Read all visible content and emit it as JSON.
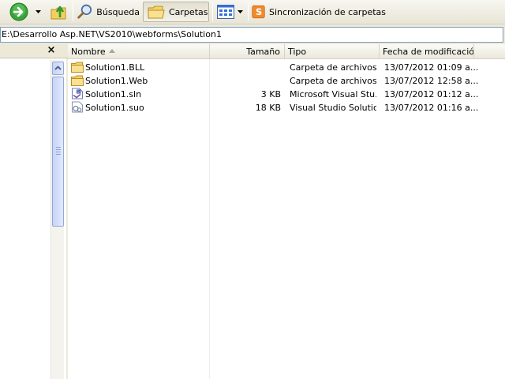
{
  "toolbar": {
    "search_label": "Búsqueda",
    "folders_label": "Carpetas",
    "sync_label": "Sincronización de carpetas"
  },
  "address": {
    "path": "E:\\Desarrollo Asp.NET\\VS2010\\webforms\\Solution1"
  },
  "folder_pane": {
    "close_glyph": "×"
  },
  "columns": {
    "name": "Nombre",
    "size": "Tamaño",
    "type": "Tipo",
    "modified": "Fecha de modificación"
  },
  "files": [
    {
      "name": "Solution1.BLL",
      "size": "",
      "type": "Carpeta de archivos",
      "modified": "13/07/2012 01:09 a...",
      "icon": "folder-icon"
    },
    {
      "name": "Solution1.Web",
      "size": "",
      "type": "Carpeta de archivos",
      "modified": "13/07/2012 12:58 a...",
      "icon": "folder-icon"
    },
    {
      "name": "Solution1.sln",
      "size": "3 KB",
      "type": "Microsoft Visual Stu...",
      "modified": "13/07/2012 01:12 a...",
      "icon": "sln-file-icon"
    },
    {
      "name": "Solution1.suo",
      "size": "18 KB",
      "type": "Visual Studio Solutio...",
      "modified": "13/07/2012 01:16 a...",
      "icon": "suo-file-icon"
    }
  ],
  "colors": {
    "toolbar_bg": "#ece9d8",
    "address_border": "#7f9db9",
    "scrollbar": "#c6d3f7",
    "folder_yellow": "#f5d36b"
  }
}
